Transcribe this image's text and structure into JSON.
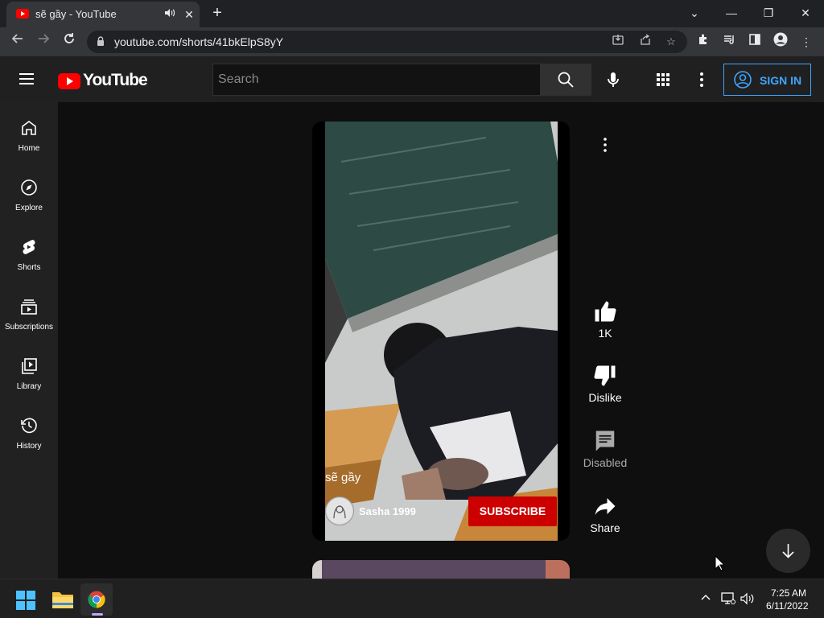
{
  "browser": {
    "tab_title": "sẽ gầy - YouTube",
    "url": "youtube.com/shorts/41bkElpS8yY",
    "new_tab_icon": "plus-icon"
  },
  "header": {
    "logo_text": "YouTube",
    "search_placeholder": "Search",
    "sign_in_label": "SIGN IN"
  },
  "sidebar": {
    "items": [
      {
        "label": "Home",
        "icon": "home-icon"
      },
      {
        "label": "Explore",
        "icon": "compass-icon"
      },
      {
        "label": "Shorts",
        "icon": "shorts-icon"
      },
      {
        "label": "Subscriptions",
        "icon": "subscriptions-icon"
      },
      {
        "label": "Library",
        "icon": "library-icon"
      },
      {
        "label": "History",
        "icon": "history-icon"
      }
    ]
  },
  "short": {
    "title": "sẽ gầy",
    "channel": "Sasha 1999",
    "subscribe_label": "SUBSCRIBE"
  },
  "actions": {
    "like_count": "1K",
    "dislike_label": "Dislike",
    "comments_label": "Disabled",
    "share_label": "Share"
  },
  "taskbar": {
    "time": "7:25 AM",
    "date": "6/11/2022"
  },
  "colors": {
    "accent_blue": "#3ea6ff",
    "subscribe_red": "#cc0000",
    "brand_red": "#ff0000"
  }
}
